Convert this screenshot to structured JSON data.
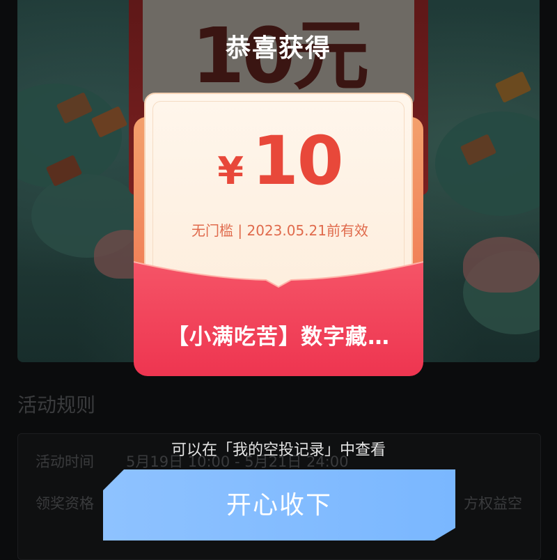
{
  "background": {
    "banner_text": "10元",
    "rules_title": "活动规则",
    "rules": [
      {
        "label": "活动时间",
        "value": "5月19日 10:00 - 5月21日 24:00"
      },
      {
        "label": "领奖资格",
        "value": "方权益空"
      }
    ]
  },
  "modal": {
    "title": "恭喜获得",
    "coupon": {
      "currency": "¥",
      "amount": "10",
      "validity": "无门槛 | 2023.05.21前有效",
      "name": "【小满吃苦】数字藏…"
    },
    "hint": "可以在「我的空投记录」中查看",
    "accept_label": "开心收下"
  },
  "colors": {
    "accent_red": "#e8483a",
    "envelope_red": "#f0465a",
    "button_blue": "#7ab7ff"
  }
}
